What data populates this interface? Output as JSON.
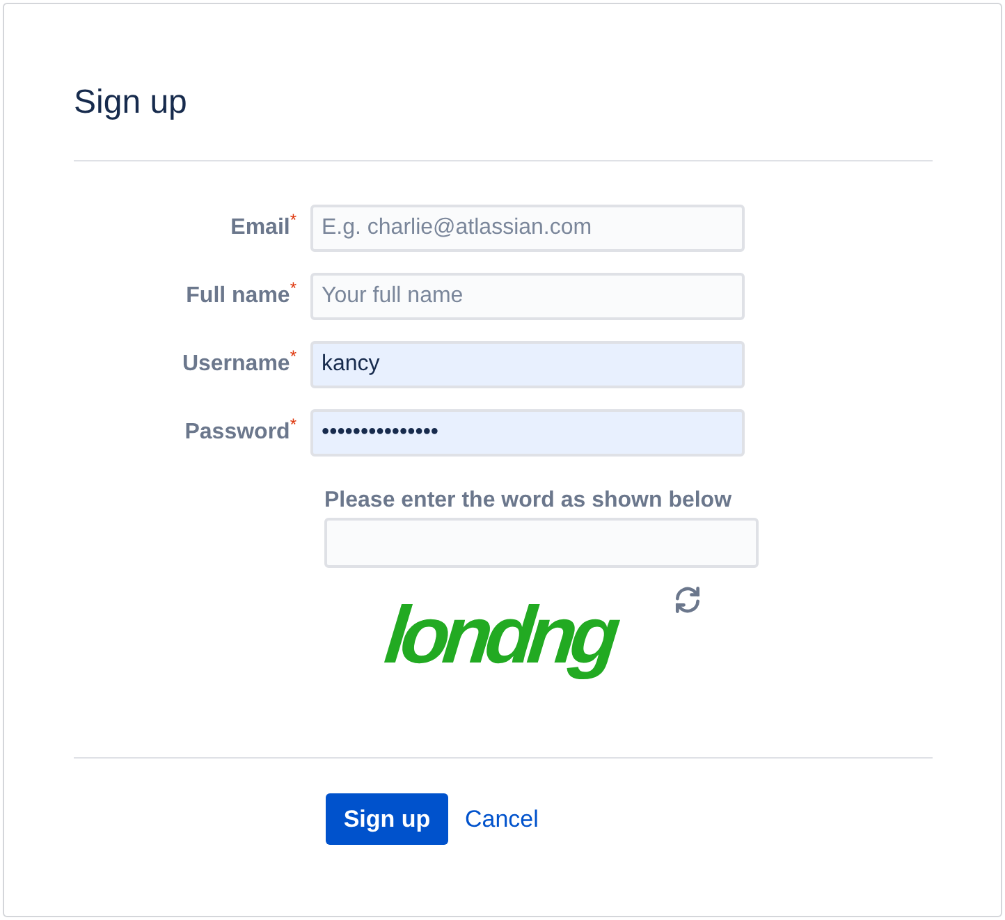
{
  "title": "Sign up",
  "fields": [
    {
      "label": "Email",
      "required_mark": "*",
      "placeholder": "E.g. charlie@atlassian.com",
      "autofilled": false
    },
    {
      "label": "Full name",
      "required_mark": "*",
      "placeholder": "Your full name",
      "autofilled": false
    },
    {
      "label": "Username",
      "required_mark": "*",
      "value": "kancy",
      "autofilled": true
    },
    {
      "label": "Password",
      "required_mark": "*",
      "value": "•••••••••••••••",
      "autofilled": true
    }
  ],
  "captcha": {
    "label": "Please enter the word as shown below",
    "word": "londng"
  },
  "buttons": {
    "submit": "Sign up",
    "cancel": "Cancel"
  }
}
